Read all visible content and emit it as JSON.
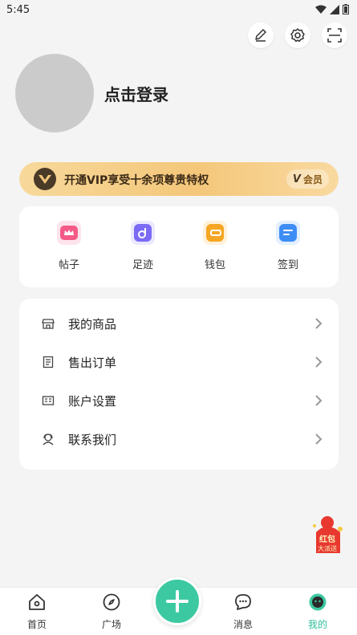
{
  "status_bar": {
    "time": "5:45"
  },
  "profile": {
    "login_text": "点击登录"
  },
  "vip": {
    "text": "开通VIP享受十余项尊贵特权",
    "badge_v": "V",
    "badge_label": "会员"
  },
  "quick_actions": [
    {
      "label": "帖子",
      "icon": "crown-icon",
      "color": "#f45a87"
    },
    {
      "label": "足迹",
      "icon": "footprint-icon",
      "color": "#7a6af5"
    },
    {
      "label": "钱包",
      "icon": "wallet-icon",
      "color": "#f6a623"
    },
    {
      "label": "签到",
      "icon": "checkin-icon",
      "color": "#3d8df5"
    }
  ],
  "menu": [
    {
      "label": "我的商品",
      "icon": "store-icon"
    },
    {
      "label": "售出订单",
      "icon": "order-icon"
    },
    {
      "label": "账户设置",
      "icon": "account-icon"
    },
    {
      "label": "联系我们",
      "icon": "contact-icon"
    }
  ],
  "promo": {
    "line1": "红包",
    "line2": "大派送"
  },
  "bottom_nav": [
    {
      "label": "首页",
      "icon": "home-icon"
    },
    {
      "label": "广场",
      "icon": "compass-icon"
    },
    {
      "label": "消息",
      "icon": "message-icon"
    },
    {
      "label": "我的",
      "icon": "profile-face-icon"
    }
  ],
  "colors": {
    "accent": "#3cc9a1",
    "active_nav": "#2fbf9b"
  }
}
